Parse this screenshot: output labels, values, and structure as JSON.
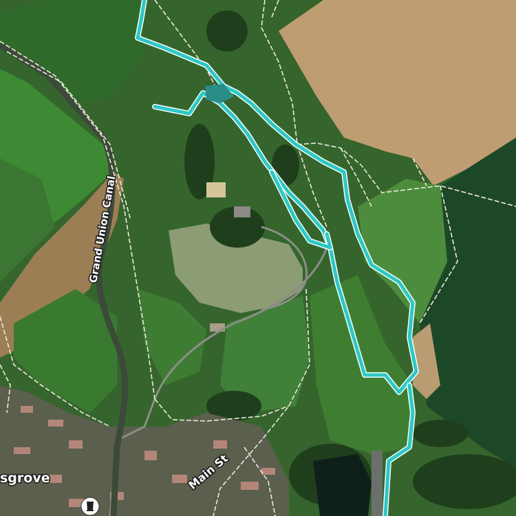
{
  "labels": {
    "canal": "Grand Union Canal",
    "street": "Main St",
    "town_partial": "sgrove"
  },
  "icons": {
    "poi": "pub-icon"
  },
  "colors": {
    "route": "#2ec7c4",
    "path": "#efeadf",
    "field_light": "#c7a87d",
    "field_dark": "#1f4a29",
    "grass": "#3f7a33"
  }
}
